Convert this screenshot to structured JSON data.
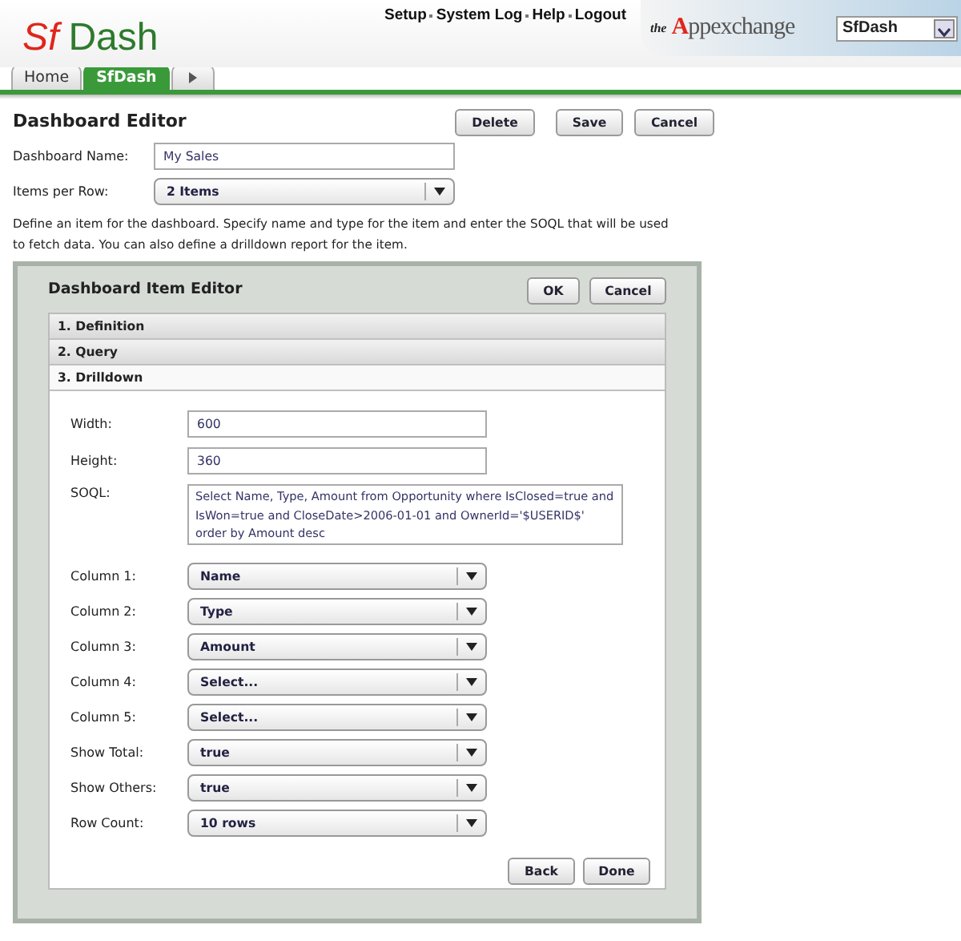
{
  "header": {
    "logo": {
      "part1": "Sf",
      "part2": "Dash"
    },
    "links": [
      "Setup",
      "System Log",
      "Help",
      "Logout"
    ],
    "brand": {
      "prefix": "the",
      "name": "Appexchange"
    },
    "app_select": {
      "value": "SfDash"
    }
  },
  "tabs": [
    {
      "kind": "tab",
      "label": "Home",
      "selected": false
    },
    {
      "kind": "tab",
      "label": "SfDash",
      "selected": true
    },
    {
      "kind": "more",
      "selected": false
    }
  ],
  "editor": {
    "title": "Dashboard Editor",
    "buttons": [
      "Delete",
      "Save",
      "Cancel"
    ],
    "fields": [
      {
        "kind": "text",
        "label": "Dashboard Name:",
        "value": "My Sales"
      },
      {
        "kind": "select",
        "label": "Items per Row:",
        "value": "2 Items"
      }
    ],
    "description": "Define an item for the dashboard. Specify name and type for the item and enter the SOQL that will be used to fetch data. You can also define a drilldown report for the item."
  },
  "item_editor": {
    "title": "Dashboard Item Editor",
    "buttons": [
      "OK",
      "Cancel"
    ],
    "sections": [
      {
        "label": "1. Definition",
        "expanded": false
      },
      {
        "label": "2. Query",
        "expanded": false
      },
      {
        "label": "3. Drilldown",
        "expanded": true
      }
    ],
    "fields": [
      {
        "kind": "text",
        "label": "Width:",
        "value": "600"
      },
      {
        "kind": "text",
        "label": "Height:",
        "value": "360"
      },
      {
        "kind": "textarea",
        "label": "SOQL:",
        "value": "Select Name, Type, Amount from Opportunity where IsClosed=true and IsWon=true and CloseDate>2006-01-01 and OwnerId='$USERID$' order by Amount desc"
      },
      {
        "kind": "select",
        "label": "Column 1:",
        "value": "Name"
      },
      {
        "kind": "select",
        "label": "Column 2:",
        "value": "Type"
      },
      {
        "kind": "select",
        "label": "Column 3:",
        "value": "Amount"
      },
      {
        "kind": "select",
        "label": "Column 4:",
        "value": "Select..."
      },
      {
        "kind": "select",
        "label": "Column 5:",
        "value": "Select..."
      },
      {
        "kind": "select",
        "label": "Show Total:",
        "value": "true"
      },
      {
        "kind": "select",
        "label": "Show Others:",
        "value": "true"
      },
      {
        "kind": "select",
        "label": "Row Count:",
        "value": "10 rows"
      }
    ],
    "footer_buttons": [
      "Back",
      "Done"
    ]
  }
}
